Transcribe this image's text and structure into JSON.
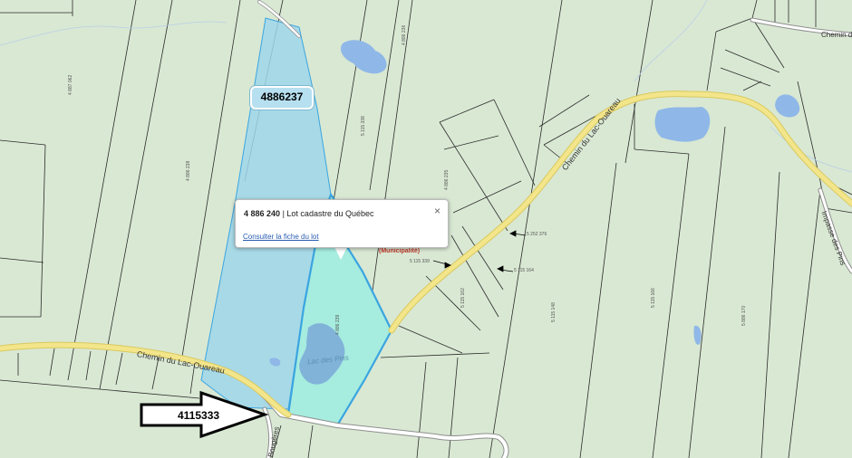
{
  "popup": {
    "lot_number": "4 886 240",
    "separator": "|",
    "lot_type": "Lot cadastre du Québec",
    "link_text": "Consulter la fiche du lot",
    "close_symbol": "×"
  },
  "labels": {
    "lot_tag": "4886237",
    "arrow_lot": "4115333",
    "municipality": "(Municipalité)",
    "lake": "Lac des Pins"
  },
  "roads": {
    "main_road_west": "Chemin du Lac-Ouareau",
    "main_road_east": "Chemin du Lac-Ouareau",
    "north_road": "Chemin du",
    "side_road_south": "Bougères",
    "side_road_east": "Impasse des Pins"
  },
  "small_lot_numbers": [
    "4 887 062",
    "4 886 238",
    "4 886 239",
    "4 886 236",
    "4 886 235",
    "5 115 338",
    "5 252 376",
    "5 115 339",
    "5 115 162",
    "5 115 164",
    "5 115 148",
    "5 115 166",
    "5 886 170"
  ],
  "colors": {
    "background": "#d9e8d3",
    "lot_highlight": "#9fd6ea",
    "selected_lot": "#a6ecdf",
    "selected_border": "#3aa5e0",
    "road": "#f3e58a",
    "water": "#8fb8e8",
    "municipality_text": "#c0392b"
  }
}
